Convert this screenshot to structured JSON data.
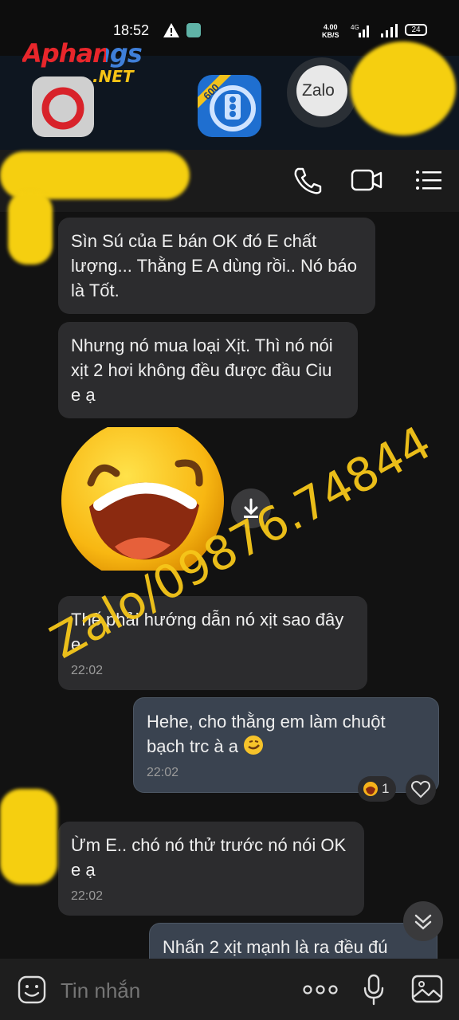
{
  "status_bar": {
    "time": "18:52",
    "net_speed_value": "4.00",
    "net_speed_unit": "KB/S",
    "network": "4G",
    "battery": "24"
  },
  "watermark_brand": {
    "main": "Aphangs",
    "sub": ".NET"
  },
  "home_icons": {
    "traffic_badge": "600",
    "zalo_label": "Zalo"
  },
  "header": {
    "icons": [
      "phone-icon",
      "video-call-icon",
      "menu-list-icon"
    ]
  },
  "messages": [
    {
      "id": "m1",
      "direction": "in",
      "text": "Sìn Sú của E bán OK đó E chất lượng... Thằng E A dùng rồi.. Nó báo là Tốt."
    },
    {
      "id": "m2",
      "direction": "in",
      "text": "Nhưng nó mua loại Xịt. Thì nó nói xịt 2 hơi không đều được đầu Ciu e ạ"
    },
    {
      "id": "m3",
      "direction": "in",
      "type": "sticker",
      "sticker": "laughing-face"
    },
    {
      "id": "m4",
      "direction": "in",
      "text": " Thế phải hướng dẫn nó xịt sao đây e",
      "time": "22:02"
    },
    {
      "id": "m5",
      "direction": "out",
      "text": "Hehe, cho thằng em làm chuột bạch trc à a ",
      "time": "22:02",
      "reaction_count": "1"
    },
    {
      "id": "m6",
      "direction": "in",
      "text": "Ừm E.. chó nó thử trước nó nói OK e ạ",
      "time": "22:02"
    },
    {
      "id": "m7",
      "direction": "out",
      "text": "Nhấn 2 xịt mạnh là ra đều đú"
    }
  ],
  "overlay_watermark": "Zalo/09876.74844",
  "composer": {
    "placeholder": "Tin nhắn",
    "icons": [
      "emoji-icon",
      "more-options-icon",
      "microphone-icon",
      "image-icon"
    ]
  },
  "colors": {
    "background": "#121212",
    "bubble_in": "#2c2c2e",
    "bubble_out": "#3a4350",
    "watermark": "#f6c71a",
    "redaction": "#f5cf10"
  }
}
